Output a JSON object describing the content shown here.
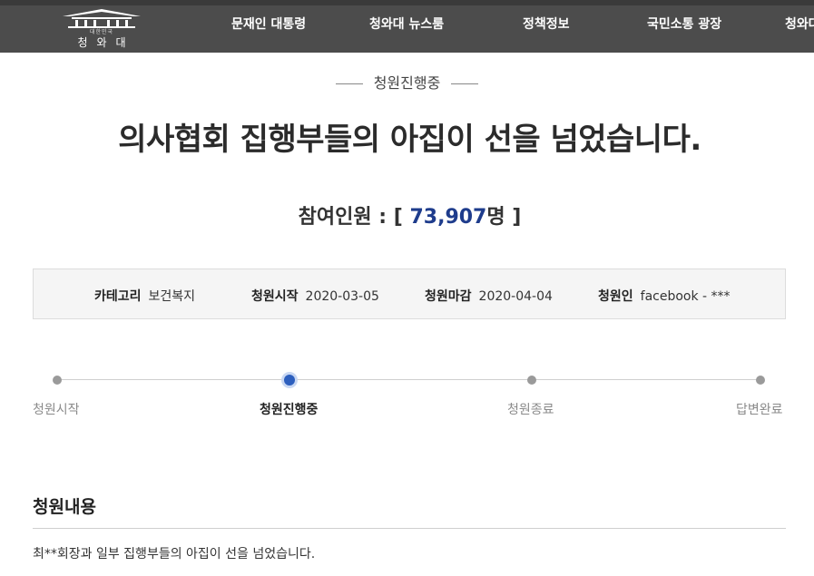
{
  "header": {
    "logo_sub": "대한민국",
    "logo_main": "청와대",
    "nav": [
      "문재인 대통령",
      "청와대 뉴스룸",
      "정책정보",
      "국민소통 광장",
      "청와대"
    ]
  },
  "petition": {
    "status": "청원진행중",
    "title": "의사협회 집행부들의 아집이 선을 넘었습니다.",
    "count_label": "참여인원 : [",
    "count_value": "73,907",
    "count_unit": "명 ]",
    "info": [
      {
        "key": "카테고리",
        "value": "보건복지"
      },
      {
        "key": "청원시작",
        "value": "2020-03-05"
      },
      {
        "key": "청원마감",
        "value": "2020-04-04"
      },
      {
        "key": "청원인",
        "value": "facebook - ***"
      }
    ],
    "steps": [
      "청원시작",
      "청원진행중",
      "청원종료",
      "답변완료"
    ],
    "active_step_index": 1,
    "content_heading": "청원내용",
    "content_first_line": "최**회장과 일부 집행부들의 아집이 선을 넘었습니다."
  },
  "colors": {
    "nav_bg": "#4c4c4c",
    "accent": "#1e3c8c",
    "active_dot": "#2d5fbe"
  }
}
